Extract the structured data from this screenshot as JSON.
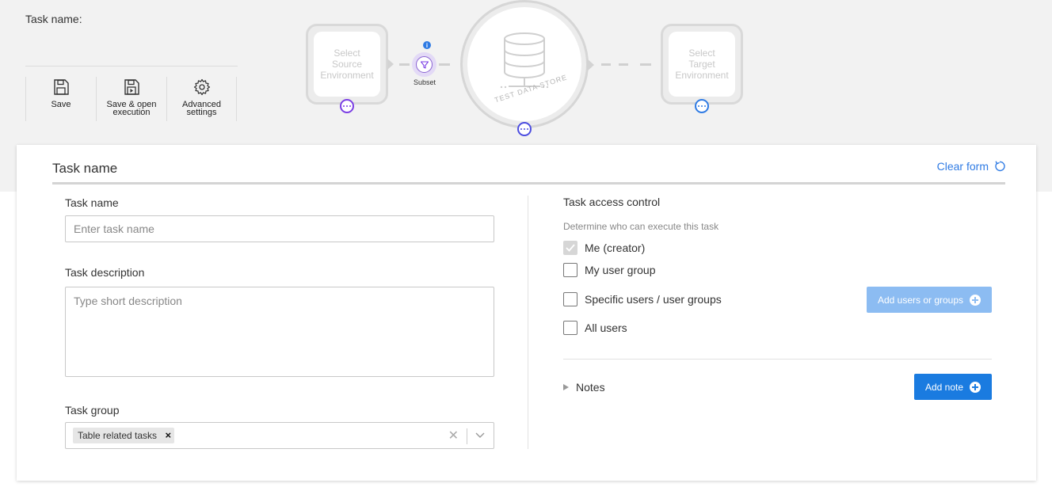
{
  "header": {
    "task_name_label": "Task name:"
  },
  "toolbar": {
    "save": "Save",
    "save_open": "Save & open\nexecution",
    "advanced": "Advanced\nsettings"
  },
  "flow": {
    "source_env": "Select\nSource\nEnvironment",
    "subset_label": "Subset",
    "subset_info": "i",
    "store_label": "TEST DATA STORE",
    "target_env": "Select\nTarget\nEnvironment"
  },
  "form": {
    "title": "Task name",
    "clear_form": "Clear form",
    "task_name_label": "Task name",
    "task_name_placeholder": "Enter task name",
    "task_name_value": "",
    "task_description_label": "Task description",
    "task_description_placeholder": "Type short description",
    "task_group_label": "Task group",
    "task_group_selected": [
      "Table related tasks"
    ]
  },
  "access": {
    "title": "Task access control",
    "hint": "Determine who can execute this task",
    "options": [
      {
        "label": "Me (creator)",
        "checked": true,
        "disabled": true
      },
      {
        "label": "My user group",
        "checked": false
      },
      {
        "label": "Specific users / user groups",
        "checked": false
      },
      {
        "label": "All users",
        "checked": false
      }
    ],
    "add_users_button": "Add users or groups"
  },
  "notes": {
    "label": "Notes",
    "add_note_button": "Add note"
  },
  "colors": {
    "accent": "#1a7be0",
    "accent_light": "#8cbcf2",
    "subset_purple": "#7b3fe4"
  }
}
